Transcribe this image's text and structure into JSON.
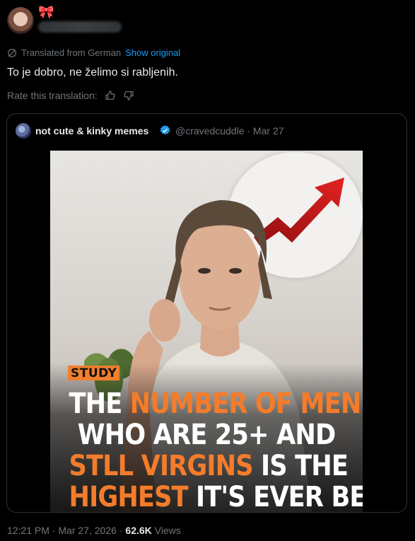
{
  "header": {
    "bow_emoji": "🎀"
  },
  "translation": {
    "label": "Translated from German",
    "show_original": "Show original",
    "text": "To je dobro, ne želimo si rabljenih.",
    "rate_label": "Rate this translation:"
  },
  "quote": {
    "name": "not cute & kinky memes",
    "handle_date": "@cravedcuddle · Mar 27",
    "image": {
      "tag": "STUDY",
      "line1_a": "THE ",
      "line1_b": "NUMBER OF MEN",
      "line2": "WHO ARE 25+ AND",
      "line3_a": "STLL VIRGINS",
      "line3_b": " IS THE",
      "line4_a": "HIGHEST",
      "line4_b": " IT'S EVER BEEN"
    }
  },
  "footer": {
    "time_date": "12:21 PM · Mar 27, 2026 ·",
    "views_count": "62.6K",
    "views_label": "Views"
  },
  "colors": {
    "accent": "#1d9bf0",
    "headline_orange": "#f47c2a",
    "muted": "#71767b"
  }
}
